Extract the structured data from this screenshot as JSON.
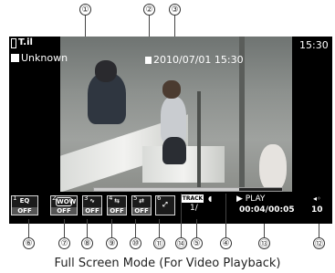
{
  "callouts": [
    "①",
    "②",
    "③",
    "④",
    "⑤",
    "⑥",
    "⑦",
    "⑧",
    "⑨",
    "⑩",
    "⑪",
    "⑫",
    "⑬",
    "⑭"
  ],
  "status": {
    "clock": "15:30",
    "signal_label": "T.il"
  },
  "overlay": {
    "title": "Unknown",
    "datetime": "2010/07/01 15:30"
  },
  "controls": [
    {
      "num": "1",
      "label": "EQ",
      "value": "OFF"
    },
    {
      "num": "2",
      "label": "WOW",
      "value": "OFF"
    },
    {
      "num": "3",
      "label": "",
      "value": "OFF"
    },
    {
      "num": "4",
      "label": "",
      "value": "OFF"
    },
    {
      "num": "5",
      "label": "",
      "value": "OFF"
    },
    {
      "num": "6",
      "label": "",
      "value": ""
    }
  ],
  "track": {
    "label": "TRACK",
    "value": "1/"
  },
  "playback": {
    "state": "PLAY",
    "elapsed": "00:04",
    "total": "00:05",
    "volume": "10"
  },
  "progress": {
    "fraction": 0.77
  },
  "caption": "Full Screen Mode (For Video Playback)"
}
